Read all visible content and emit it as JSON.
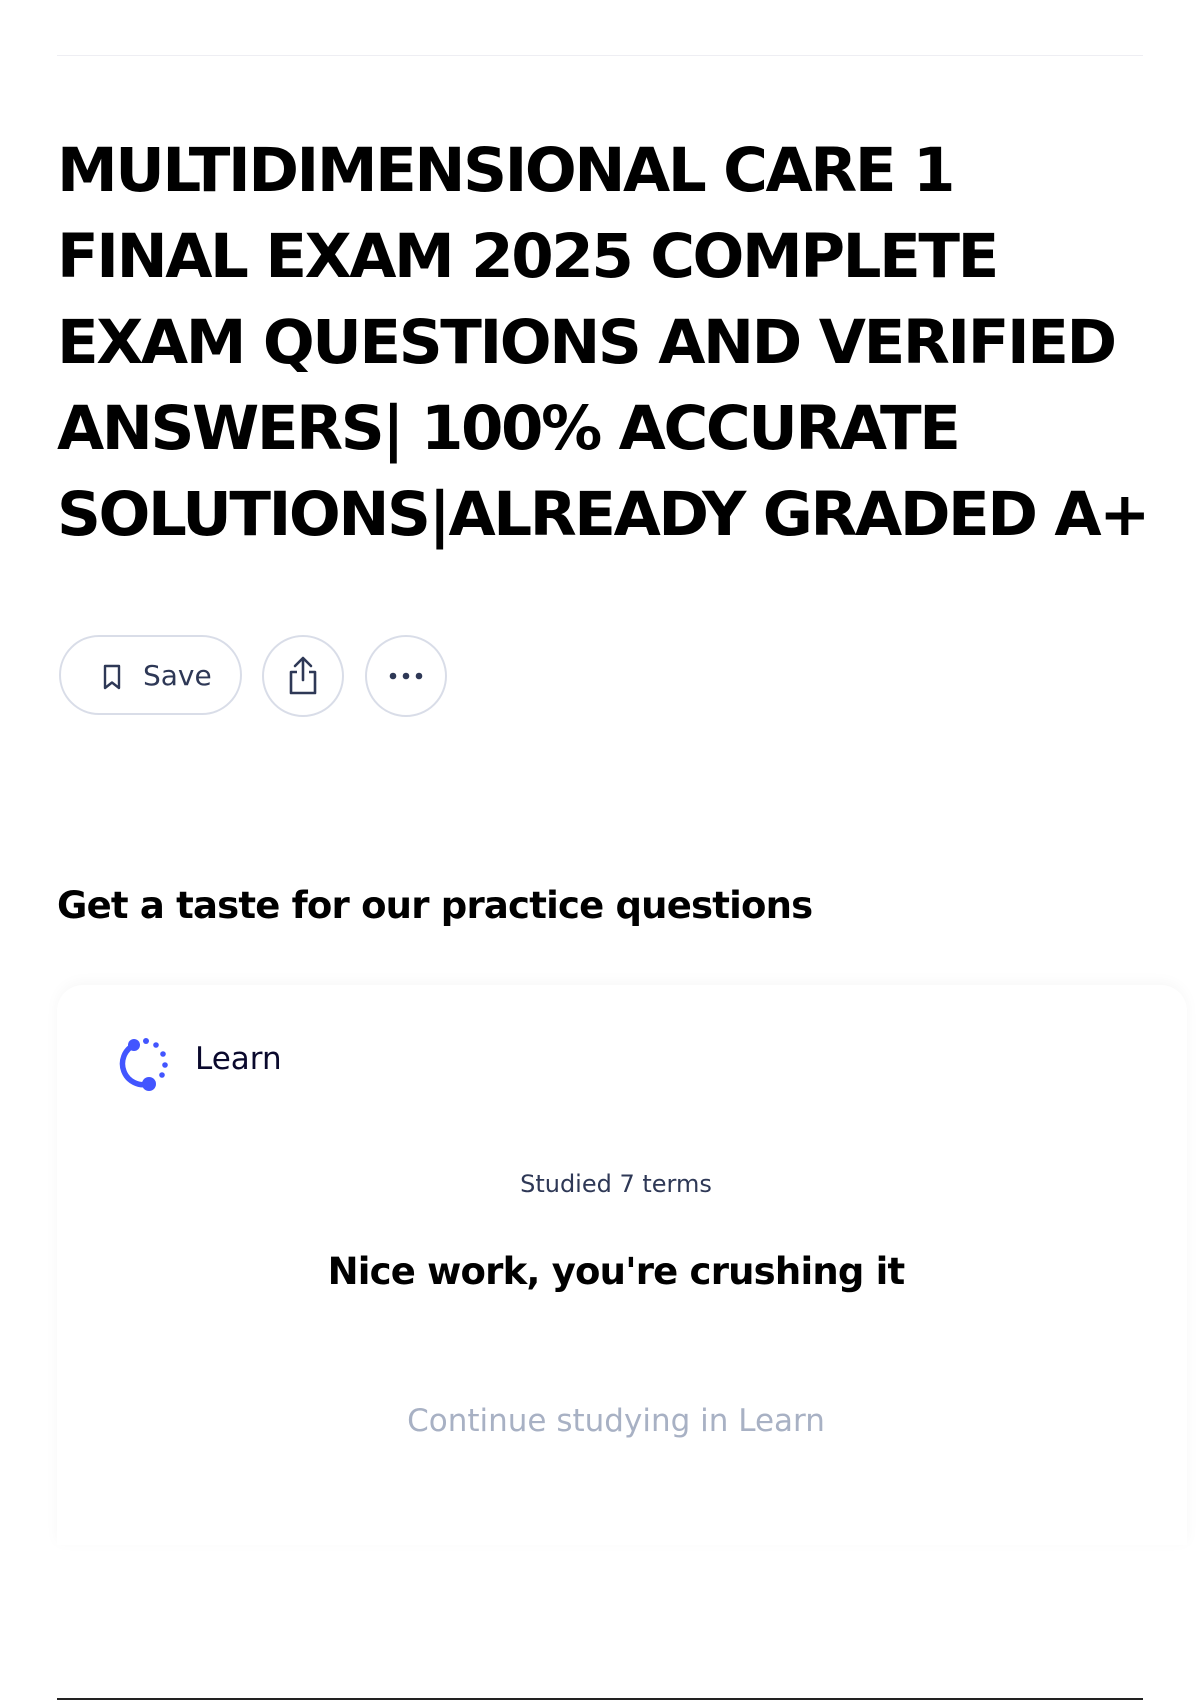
{
  "title": {
    "lines": [
      "MULTIDIMENSIONAL CARE 1",
      "FINAL EXAM 2025 COMPLETE",
      "EXAM QUESTIONS AND VERIFIED",
      "ANSWERS| 100% ACCURATE",
      "SOLUTIONS|ALREADY GRADED A+"
    ]
  },
  "actions": {
    "save_label": "Save",
    "save_icon": "bookmark-icon",
    "share_icon": "share-icon",
    "more_icon": "more-icon"
  },
  "practice": {
    "heading": "Get a taste for our practice questions",
    "card": {
      "mode_label": "Learn",
      "mode_icon": "learn-icon",
      "studied": "Studied 7 terms",
      "message": "Nice work, you're crushing it",
      "continue_label": "Continue studying in Learn"
    }
  },
  "colors": {
    "accent": "#4255ff",
    "muted_text": "#a8b1c4",
    "border": "#d9dde8"
  }
}
